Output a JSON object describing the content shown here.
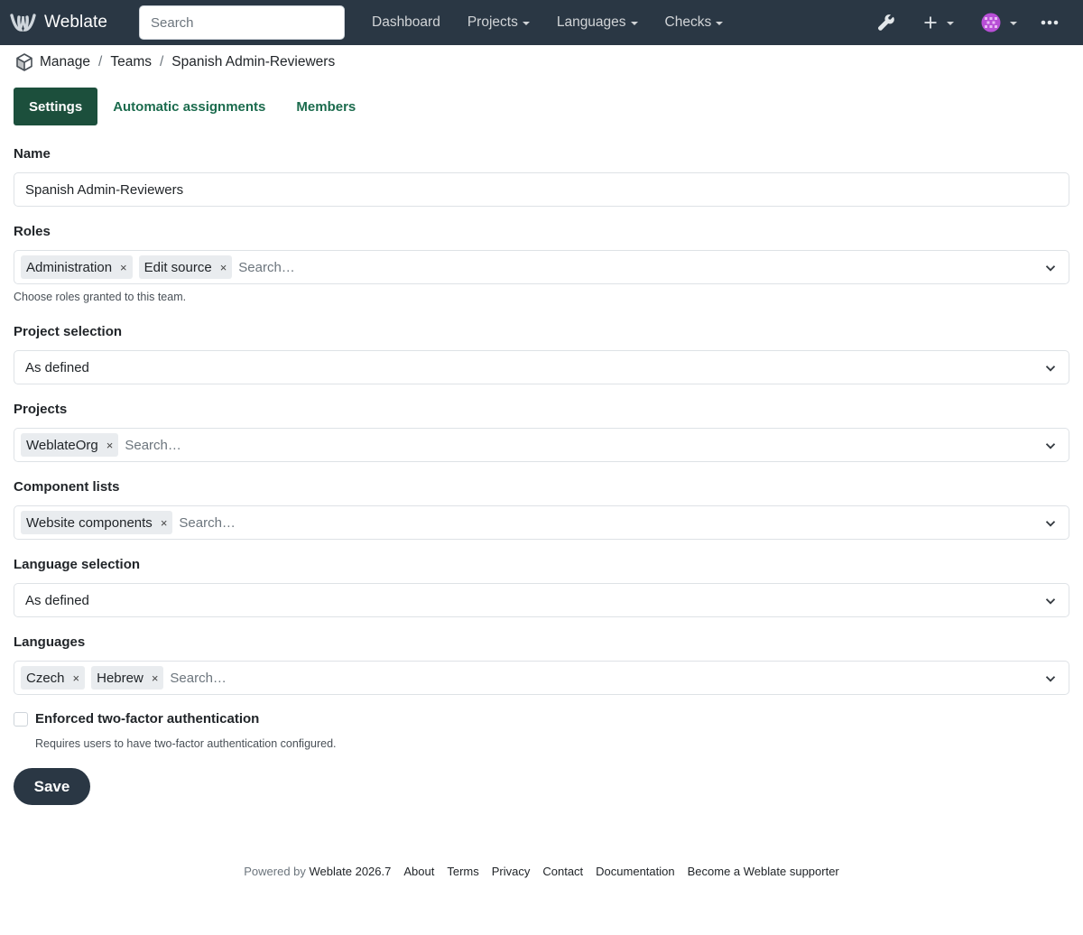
{
  "navbar": {
    "brand": "Weblate",
    "search_placeholder": "Search",
    "links": [
      {
        "label": "Dashboard",
        "dropdown": false
      },
      {
        "label": "Projects",
        "dropdown": true
      },
      {
        "label": "Languages",
        "dropdown": true
      },
      {
        "label": "Checks",
        "dropdown": true
      }
    ],
    "icons": [
      "wrench-icon",
      "plus-icon",
      "avatar",
      "more-icon"
    ]
  },
  "breadcrumb": {
    "items": [
      "Manage",
      "Teams",
      "Spanish Admin-Reviewers"
    ],
    "separator": "/"
  },
  "tabs": [
    {
      "label": "Settings",
      "active": true
    },
    {
      "label": "Automatic assignments",
      "active": false
    },
    {
      "label": "Members",
      "active": false
    }
  ],
  "form": {
    "name": {
      "label": "Name",
      "value": "Spanish Admin-Reviewers"
    },
    "roles": {
      "label": "Roles",
      "tags": [
        "Administration",
        "Edit source"
      ],
      "placeholder": "Search…",
      "help": "Choose roles granted to this team."
    },
    "project_selection": {
      "label": "Project selection",
      "value": "As defined"
    },
    "projects": {
      "label": "Projects",
      "tags": [
        "WeblateOrg"
      ],
      "placeholder": "Search…"
    },
    "component_lists": {
      "label": "Component lists",
      "tags": [
        "Website components"
      ],
      "placeholder": "Search…"
    },
    "language_selection": {
      "label": "Language selection",
      "value": "As defined"
    },
    "languages": {
      "label": "Languages",
      "tags": [
        "Czech",
        "Hebrew"
      ],
      "placeholder": "Search…"
    },
    "two_factor": {
      "label": "Enforced two-factor authentication",
      "help": "Requires users to have two-factor authentication configured.",
      "checked": false
    },
    "remove_symbol": "×",
    "save_label": "Save"
  },
  "footer": {
    "powered_prefix": "Powered by",
    "powered_link": "Weblate 2026.7",
    "links": [
      "About",
      "Terms",
      "Privacy",
      "Contact",
      "Documentation",
      "Become a Weblate supporter"
    ]
  },
  "colors": {
    "navbar": "#2a3744",
    "tab_active": "#1c4f3c",
    "tab_link": "#1b6b4d"
  }
}
